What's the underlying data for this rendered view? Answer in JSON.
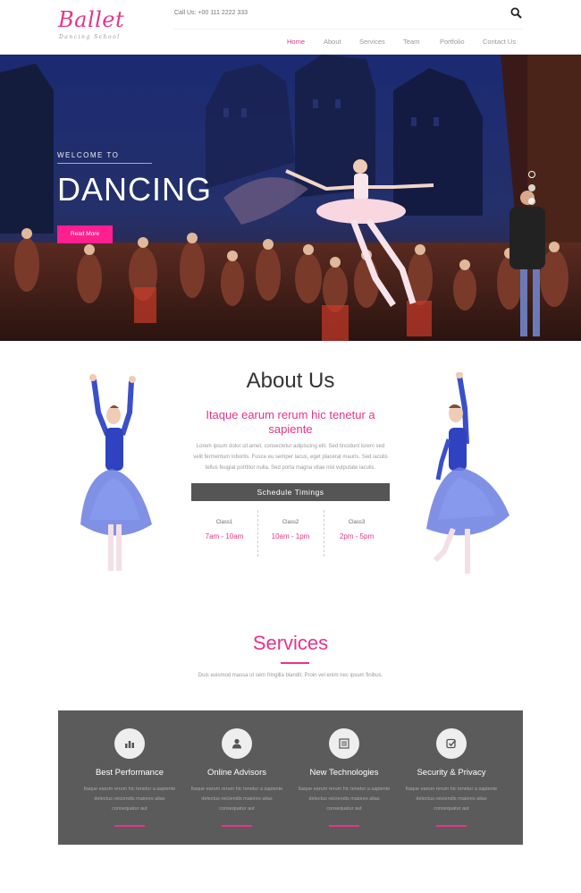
{
  "header": {
    "logo_title": "Ballet",
    "logo_subtitle": "Dancing School",
    "call_us": "Call Us: +00 111 2222 333",
    "search_icon": "search-icon",
    "nav": [
      {
        "label": "Home",
        "active": true
      },
      {
        "label": "About",
        "active": false
      },
      {
        "label": "Services",
        "active": false
      },
      {
        "label": "Team",
        "active": false
      },
      {
        "label": "Portfolio",
        "active": false
      },
      {
        "label": "Contact Us",
        "active": false
      }
    ]
  },
  "hero": {
    "welcome": "WELCOME TO",
    "title": "DANCING",
    "button": "Read More",
    "slides": 3,
    "active_slide": 1
  },
  "about": {
    "title": "About Us",
    "subtitle": "Itaque earum rerum hic tenetur a sapiente",
    "body": "Lorem ipsum dolor sit amet, consectetur adipiscing elit. Sed tincidunt lorem sed velit fermentum lobortis. Fusce eu semper lacus, eget placerat mauris. Sed iaculis tellus feugiat porttitor nulla. Sed porta magna vitae nisl vulputate iaculis.",
    "schedule_title": "Schedule Timings",
    "classes": [
      {
        "name": "Class1",
        "time": "7am - 10am"
      },
      {
        "name": "Class2",
        "time": "10am - 1pm"
      },
      {
        "name": "Class3",
        "time": "2pm - 5pm"
      }
    ]
  },
  "services": {
    "title": "Services",
    "description": "Duis euismod massa ut sem fringilla blandit. Proin vel enim nec ipsum finibus.",
    "items": [
      {
        "title": "Best Performance",
        "icon": "bar-chart-icon",
        "text": "Itaque earum rerum hic tenetur a sapiente delectus reiciendis maiores alias consequatur aut"
      },
      {
        "title": "Online Advisors",
        "icon": "user-icon",
        "text": "Itaque earum rerum hic tenetur a sapiente delectus reiciendis maiores alias consequatur aut"
      },
      {
        "title": "New Technologies",
        "icon": "list-icon",
        "text": "Itaque earum rerum hic tenetur a sapiente delectus reiciendis maiores alias consequatur aut"
      },
      {
        "title": "Security & Privacy",
        "icon": "check-square-icon",
        "text": "Itaque earum rerum hic tenetur a sapiente delectus reiciendis maiores alias consequatur aut"
      }
    ]
  },
  "colors": {
    "accent": "#e8338b",
    "button": "#ff1f8f",
    "panel": "#5b5b5b",
    "schedule_bar": "#555555"
  }
}
